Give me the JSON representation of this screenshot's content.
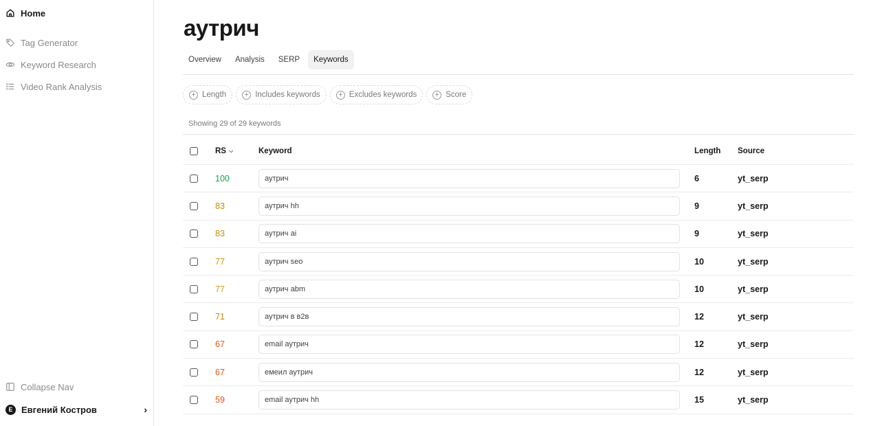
{
  "sidebar": {
    "home": "Home",
    "items": [
      {
        "label": "Tag Generator",
        "icon": "tag-icon"
      },
      {
        "label": "Keyword Research",
        "icon": "eye-icon"
      },
      {
        "label": "Video Rank Analysis",
        "icon": "list-icon"
      }
    ],
    "collapse": "Collapse Nav",
    "user": {
      "initial": "E",
      "name": "Евгений Костров"
    }
  },
  "page": {
    "title": "аутрич"
  },
  "tabs": [
    {
      "label": "Overview",
      "active": false
    },
    {
      "label": "Analysis",
      "active": false
    },
    {
      "label": "SERP",
      "active": false
    },
    {
      "label": "Keywords",
      "active": true
    }
  ],
  "filters": [
    "Length",
    "Includes keywords",
    "Excludes keywords",
    "Score"
  ],
  "showing": "Showing 29 of 29 keywords",
  "table": {
    "headers": {
      "rs": "RS",
      "keyword": "Keyword",
      "length": "Length",
      "source": "Source"
    },
    "rows": [
      {
        "rs": "100",
        "color": "#16a34a",
        "keyword": "аутрич",
        "length": "6",
        "source": "yt_serp"
      },
      {
        "rs": "83",
        "color": "#ca8a04",
        "keyword": "аутрич hh",
        "length": "9",
        "source": "yt_serp"
      },
      {
        "rs": "83",
        "color": "#ca8a04",
        "keyword": "аутрич ai",
        "length": "9",
        "source": "yt_serp"
      },
      {
        "rs": "77",
        "color": "#d49a0e",
        "keyword": "аутрич seo",
        "length": "10",
        "source": "yt_serp"
      },
      {
        "rs": "77",
        "color": "#d49a0e",
        "keyword": "аутрич abm",
        "length": "10",
        "source": "yt_serp"
      },
      {
        "rs": "71",
        "color": "#ca8a04",
        "keyword": "аутрич в в2в",
        "length": "12",
        "source": "yt_serp"
      },
      {
        "rs": "67",
        "color": "#ea580c",
        "keyword": "email аутрич",
        "length": "12",
        "source": "yt_serp"
      },
      {
        "rs": "67",
        "color": "#ea580c",
        "keyword": "емеил аутрич",
        "length": "12",
        "source": "yt_serp"
      },
      {
        "rs": "59",
        "color": "#ea580c",
        "keyword": "email аутрич hh",
        "length": "15",
        "source": "yt_serp"
      }
    ]
  }
}
